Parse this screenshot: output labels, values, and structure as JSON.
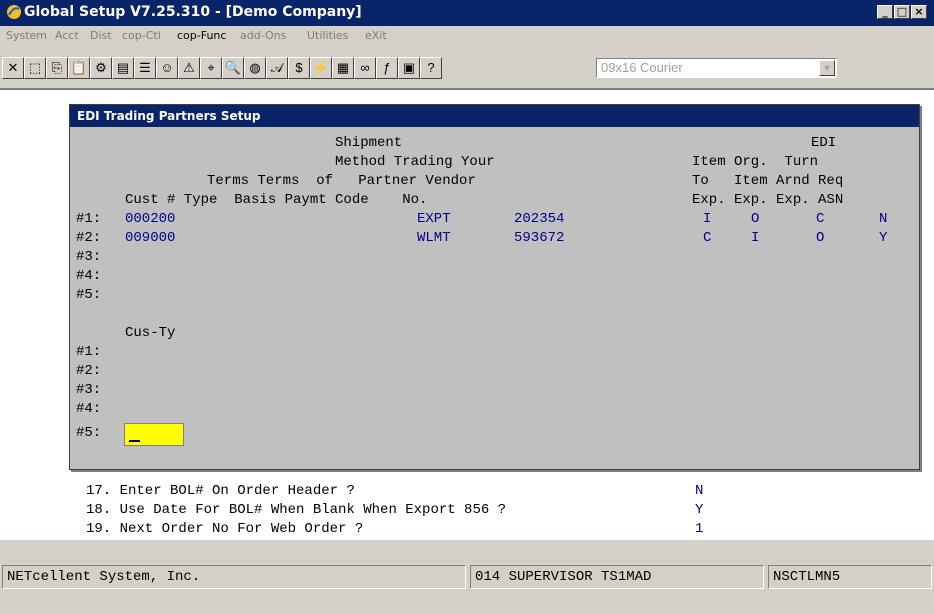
{
  "window": {
    "title": "Global Setup V7.25.310 - [Demo Company]",
    "controls": [
      "_",
      "□",
      "×"
    ]
  },
  "menu": [
    {
      "label": "System",
      "active": false
    },
    {
      "label": "Acct",
      "active": false
    },
    {
      "label": "Dist",
      "active": false
    },
    {
      "label": "cop-Ctl",
      "active": false
    },
    {
      "label": "cop-Func",
      "active": true
    },
    {
      "label": "add-Ons",
      "active": false
    },
    {
      "label": "Utilities",
      "active": false
    },
    {
      "label": "eXit",
      "active": false
    }
  ],
  "toolbar": {
    "font_select": "09x16 Courier"
  },
  "dialog": {
    "title": "EDI Trading Partners Setup",
    "headers": {
      "row1": "Shipment                                   EDI",
      "row2": "Method Trading Your              Item Org.  Turn",
      "row3": "Terms Terms  of   Partner Vendor           To   Item Arnd Req",
      "row4": "Cust # Type  Basis Paymt Code    No.              Exp. Exp. Exp.  ASN"
    },
    "rows": [
      {
        "label": "#1:",
        "cust": "000200",
        "code": "EXPT",
        "vendor": "202354",
        "item_to": "I",
        "org": "O",
        "turn": "C",
        "asn": "N"
      },
      {
        "label": "#2:",
        "cust": "009000",
        "code": "WLMT",
        "vendor": "593672",
        "item_to": "C",
        "org": "I",
        "turn": "O",
        "asn": "Y"
      },
      {
        "label": "#3:",
        "cust": "",
        "code": "",
        "vendor": "",
        "item_to": "",
        "org": "",
        "turn": "",
        "asn": ""
      },
      {
        "label": "#4:",
        "cust": "",
        "code": "",
        "vendor": "",
        "item_to": "",
        "org": "",
        "turn": "",
        "asn": ""
      },
      {
        "label": "#5:",
        "cust": "",
        "code": "",
        "vendor": "",
        "item_to": "",
        "org": "",
        "turn": "",
        "asn": ""
      }
    ],
    "custy_header": "Cus-Ty",
    "custy_rows": [
      "#1:",
      "#2:",
      "#3:",
      "#4:",
      "#5:"
    ]
  },
  "background_options": [
    {
      "label": "17. Enter BOL# On Order Header ?",
      "value": "N"
    },
    {
      "label": "18. Use Date For BOL# When Blank When Export 856 ?",
      "value": "Y"
    },
    {
      "label": "19. Next Order No For Web Order ?",
      "value": "1"
    }
  ],
  "status": {
    "company": "NETcellent System, Inc.",
    "user": "014 SUPERVISOR TS1MAD",
    "machine": "NSCTLMN5"
  }
}
